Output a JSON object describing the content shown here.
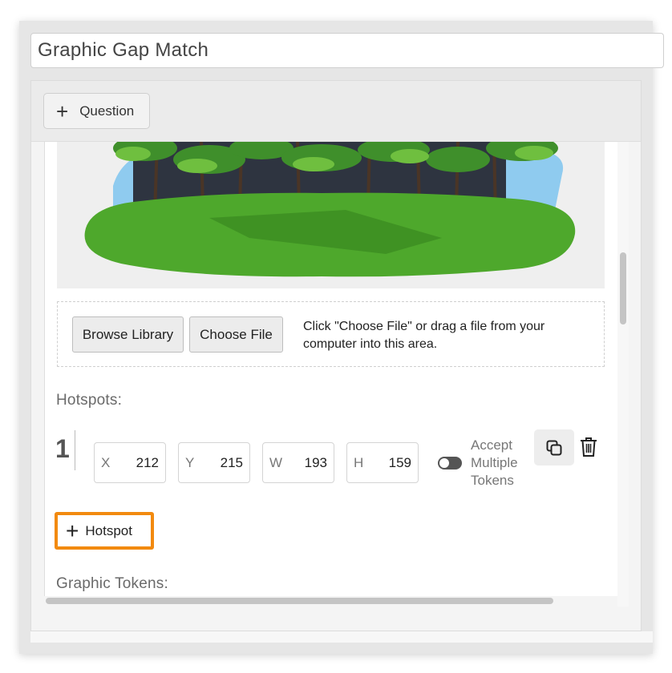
{
  "title": {
    "value": "Graphic Gap Match"
  },
  "toolbar": {
    "question_label": "Question"
  },
  "upload": {
    "browse_label": "Browse Library",
    "choose_label": "Choose File",
    "hint": "Click \"Choose File\" or drag a file from your computer into this area."
  },
  "hotspots": {
    "label": "Hotspots:",
    "items": [
      {
        "index": "1",
        "x_label": "X",
        "x": "212",
        "y_label": "Y",
        "y": "215",
        "w_label": "W",
        "w": "193",
        "h_label": "H",
        "h": "159",
        "accept_multiple_label": "Accept Multiple Tokens",
        "accept_multiple_on": false
      }
    ],
    "add_label": "Hotspot"
  },
  "tokens": {
    "label": "Graphic Tokens:"
  },
  "icons": {
    "add": "plus-icon",
    "copy": "copy-icon",
    "delete": "trash-icon"
  },
  "colors": {
    "highlight": "#f28a0f",
    "grass": "#4ea82c",
    "sky": "#8fcbef"
  }
}
